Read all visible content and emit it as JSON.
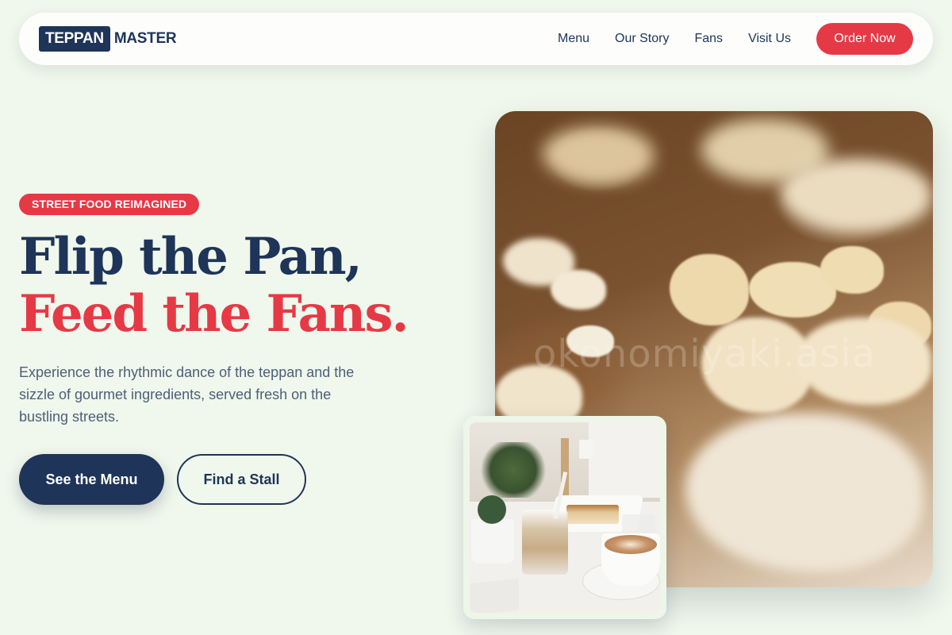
{
  "brand": {
    "logo_box": "TEPPAN",
    "logo_rest": "MASTER"
  },
  "nav": {
    "links": [
      "Menu",
      "Our Story",
      "Fans",
      "Visit Us"
    ],
    "cta": "Order Now"
  },
  "hero": {
    "badge": "STREET FOOD REIMAGINED",
    "headline_line1": "Flip the Pan,",
    "headline_line2": "Feed the Fans.",
    "lead": "Experience the rhythmic dance of the teppan and the sizzle of gourmet ingredients, served fresh on the bustling streets.",
    "primary_button": "See the Menu",
    "secondary_button": "Find a Stall",
    "image_watermark": "okonomiyaki.asia"
  },
  "colors": {
    "navy": "#1e3458",
    "accent_red": "#e63946",
    "background": "#f0f7ec"
  }
}
